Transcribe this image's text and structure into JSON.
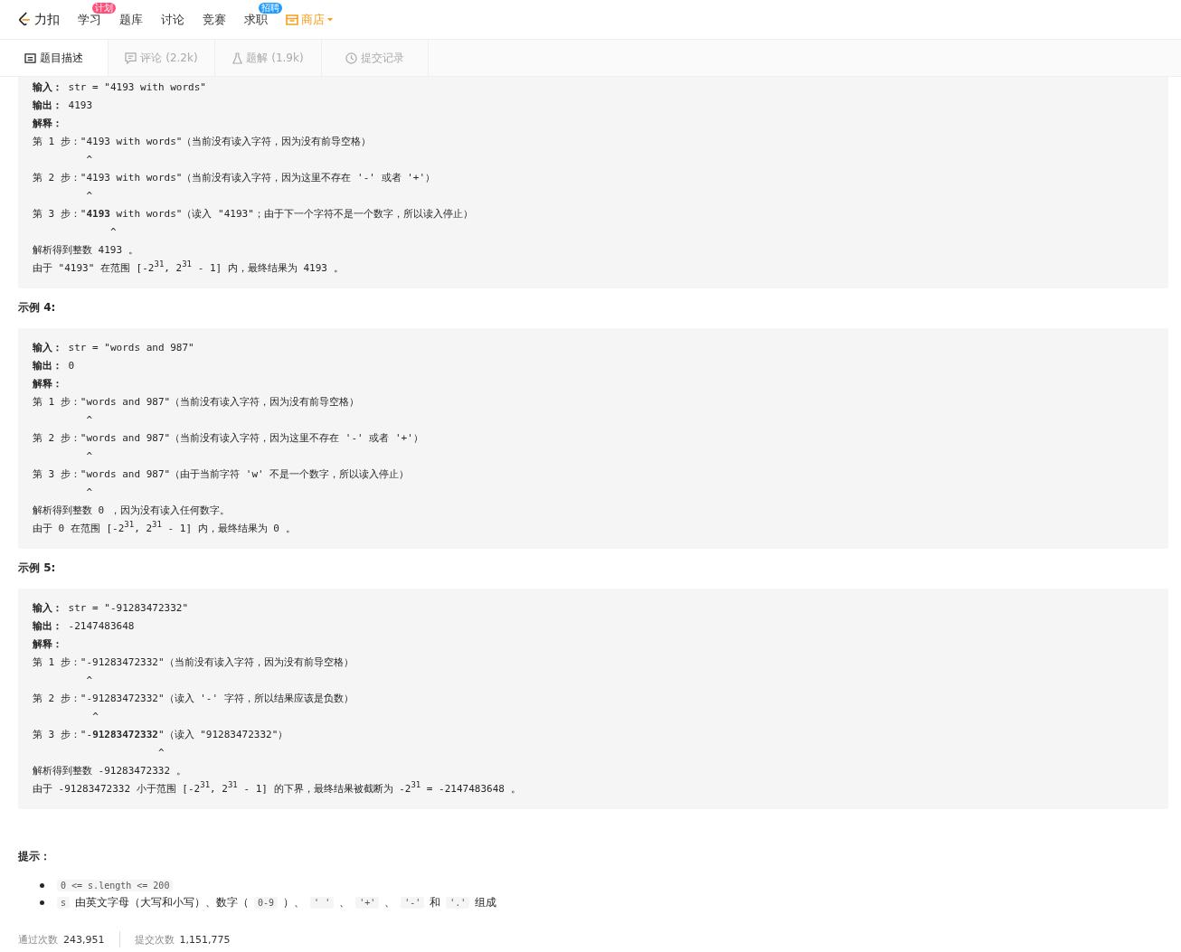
{
  "nav": {
    "logo_text": "力扣",
    "items": [
      {
        "label": "学习",
        "badge": "计划"
      },
      {
        "label": "题库"
      },
      {
        "label": "讨论"
      },
      {
        "label": "竞赛"
      },
      {
        "label": "求职",
        "badge": "招聘"
      }
    ],
    "shop": {
      "label": "商店"
    }
  },
  "tabs": [
    {
      "label": "题目描述",
      "selected": true
    },
    {
      "label": "评论 (2.2k)",
      "selected": false
    },
    {
      "label": "题解 (1.9k)",
      "selected": false
    },
    {
      "label": "提交记录",
      "selected": false
    }
  ],
  "examples": [
    {
      "lines": [
        "**输入：** str = \"4193 with words\"",
        "**输出：** 4193",
        "**解释：**",
        "第 1 步：\"4193 with words\"（当前没有读入字符，因为没有前导空格）",
        "         ^",
        "第 2 步：\"4193 with words\"（当前没有读入字符，因为这里不存在 '-' 或者 '+'）",
        "         ^",
        "第 3 步：\"**4193** with words\"（读入 \"4193\"；由于下一个字符不是一个数字，所以读入停止）",
        "             ^",
        "解析得到整数 4193 。",
        "由于 \"4193\" 在范围 [-2$^{31}$, 2$^{31}$ - 1] 内，最终结果为 4193 。"
      ]
    },
    {
      "heading": "示例 4:",
      "lines": [
        "**输入：** str = \"words and 987\"",
        "**输出：** 0",
        "**解释：**",
        "第 1 步：\"words and 987\"（当前没有读入字符，因为没有前导空格）",
        "         ^",
        "第 2 步：\"words and 987\"（当前没有读入字符，因为这里不存在 '-' 或者 '+'）",
        "         ^",
        "第 3 步：\"words and 987\"（由于当前字符 'w' 不是一个数字，所以读入停止）",
        "         ^",
        "解析得到整数 0 ，因为没有读入任何数字。",
        "由于 0 在范围 [-2$^{31}$, 2$^{31}$ - 1] 内，最终结果为 0 。"
      ]
    },
    {
      "heading": "示例 5:",
      "lines": [
        "**输入：** str = \"-91283472332\"",
        "**输出：** -2147483648",
        "**解释：**",
        "第 1 步：\"-91283472332\"（当前没有读入字符，因为没有前导空格）",
        "         ^",
        "第 2 步：\"-91283472332\"（读入 '-' 字符，所以结果应该是负数）",
        "          ^",
        "第 3 步：\"-**91283472332**\"（读入 \"91283472332\"）",
        "                     ^",
        "解析得到整数 -91283472332 。",
        "由于 -91283472332 小于范围 [-2$^{31}$, 2$^{31}$ - 1] 的下界，最终结果被截断为 -2$^{31}$ = -2147483648 。"
      ]
    }
  ],
  "hints": {
    "heading": "提示：",
    "items": [
      [
        {
          "kind": "code",
          "text": "0 <= s.length <= 200"
        }
      ],
      [
        {
          "kind": "code",
          "text": "s"
        },
        {
          "kind": "text",
          "text": "由英文字母（大写和小写）、数字（"
        },
        {
          "kind": "code",
          "text": "0-9"
        },
        {
          "kind": "text",
          "text": "）、"
        },
        {
          "kind": "code",
          "text": "' '"
        },
        {
          "kind": "text",
          "text": "、"
        },
        {
          "kind": "code",
          "text": "'+'"
        },
        {
          "kind": "text",
          "text": "、"
        },
        {
          "kind": "code",
          "text": "'-'"
        },
        {
          "kind": "text",
          "text": "和"
        },
        {
          "kind": "code",
          "text": "'.'"
        },
        {
          "kind": "text",
          "text": "组成"
        }
      ]
    ]
  },
  "stats": [
    {
      "label": "通过次数",
      "value": "243,951"
    },
    {
      "label": "提交次数",
      "value": "1,151,775"
    }
  ]
}
